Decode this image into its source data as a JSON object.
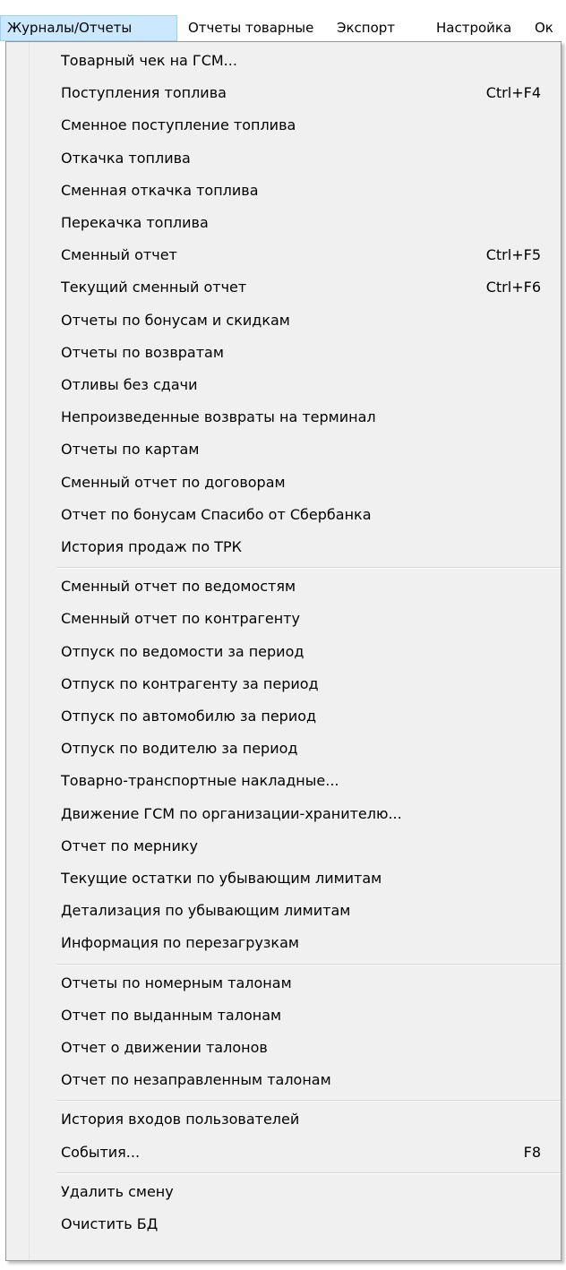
{
  "menubar": {
    "items": [
      {
        "label": "Журналы/Отчеты",
        "active": true
      },
      {
        "label": "Отчеты товарные",
        "active": false
      },
      {
        "label": "Экспорт",
        "active": false
      },
      {
        "label": "Настройка",
        "active": false
      },
      {
        "label": "Ок",
        "active": false
      }
    ]
  },
  "menu": {
    "groups": [
      [
        {
          "label": "Товарный чек на ГСМ...",
          "shortcut": ""
        },
        {
          "label": "Поступления топлива",
          "shortcut": "Ctrl+F4"
        },
        {
          "label": "Сменное поступление топлива",
          "shortcut": ""
        },
        {
          "label": "Откачка топлива",
          "shortcut": ""
        },
        {
          "label": "Сменная откачка топлива",
          "shortcut": ""
        },
        {
          "label": "Перекачка топлива",
          "shortcut": ""
        },
        {
          "label": "Сменный отчет",
          "shortcut": "Ctrl+F5"
        },
        {
          "label": "Текущий сменный отчет",
          "shortcut": "Ctrl+F6"
        },
        {
          "label": "Отчеты по бонусам и скидкам",
          "shortcut": ""
        },
        {
          "label": "Отчеты по возвратам",
          "shortcut": ""
        },
        {
          "label": "Отливы без сдачи",
          "shortcut": ""
        },
        {
          "label": "Непроизведенные возвраты на терминал",
          "shortcut": ""
        },
        {
          "label": "Отчеты по картам",
          "shortcut": ""
        },
        {
          "label": "Сменный отчет по договорам",
          "shortcut": ""
        },
        {
          "label": "Отчет по бонусам Спасибо от Сбербанка",
          "shortcut": ""
        },
        {
          "label": "История продаж по ТРК",
          "shortcut": ""
        }
      ],
      [
        {
          "label": "Сменный отчет по ведомостям",
          "shortcut": ""
        },
        {
          "label": "Сменный отчет по контрагенту",
          "shortcut": ""
        },
        {
          "label": "Отпуск по ведомости за период",
          "shortcut": ""
        },
        {
          "label": "Отпуск по контрагенту за период",
          "shortcut": ""
        },
        {
          "label": "Отпуск по автомобилю за период",
          "shortcut": ""
        },
        {
          "label": "Отпуск по водителю за период",
          "shortcut": ""
        },
        {
          "label": "Товарно-транспортные накладные...",
          "shortcut": ""
        },
        {
          "label": "Движение ГСМ по организации-хранителю...",
          "shortcut": ""
        },
        {
          "label": "Отчет по мернику",
          "shortcut": ""
        },
        {
          "label": "Текущие остатки по убывающим лимитам",
          "shortcut": ""
        },
        {
          "label": "Детализация по убывающим лимитам",
          "shortcut": ""
        },
        {
          "label": "Информация по перезагрузкам",
          "shortcut": ""
        }
      ],
      [
        {
          "label": "Отчеты по номерным талонам",
          "shortcut": ""
        },
        {
          "label": "Отчет по выданным талонам",
          "shortcut": ""
        },
        {
          "label": "Отчет о движении талонов",
          "shortcut": ""
        },
        {
          "label": "Отчет по незаправленным талонам",
          "shortcut": ""
        }
      ],
      [
        {
          "label": "История входов пользователей",
          "shortcut": ""
        },
        {
          "label": "События...",
          "shortcut": "F8"
        }
      ],
      [
        {
          "label": "Удалить смену",
          "shortcut": ""
        },
        {
          "label": "Очистить БД",
          "shortcut": ""
        }
      ]
    ]
  }
}
